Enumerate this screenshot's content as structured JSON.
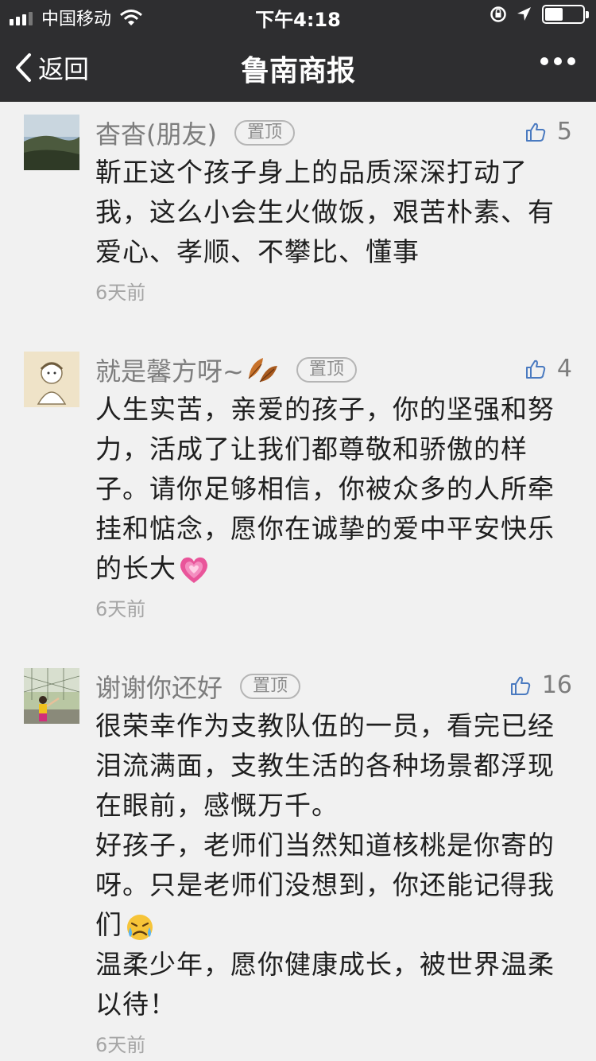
{
  "status": {
    "carrier": "中国移动",
    "time": "下午4:18"
  },
  "nav": {
    "back_label": "返回",
    "title": "鲁南商报"
  },
  "comments": [
    {
      "name": "杳杳(朋友)",
      "pin_label": "置顶",
      "likes": "5",
      "lines": [
        "靳正这个孩子身上的品质深深打动了",
        "我，这么小会生火做饭，艰苦朴素、有",
        "爱心、孝顺、不攀比、懂事"
      ],
      "time": "6天前"
    },
    {
      "name": "就是馨方呀~",
      "name_emoji": "fallen-leaf-icon",
      "pin_label": "置顶",
      "likes": "4",
      "lines": [
        "人生实苦，亲爱的孩子，你的坚强和努",
        "力，活成了让我们都尊敬和骄傲的样",
        "子。请你足够相信，你被众多的人所牵",
        "挂和惦念，愿你在诚挚的爱中平安快乐",
        "的长大"
      ],
      "line_emoji": "growing-heart-icon",
      "time": "6天前"
    },
    {
      "name": "谢谢你还好",
      "pin_label": "置顶",
      "likes": "16",
      "lines": [
        "很荣幸作为支教队伍的一员，看完已经",
        "泪流满面，支教生活的各种场景都浮现",
        "在眼前，感慨万千。",
        "好孩子，老师们当然知道核桃是你寄的",
        "呀。只是老师们没想到，你还能记得我",
        "们",
        "温柔少年，愿你健康成长，被世界温柔",
        "以待！"
      ],
      "line_emoji": "crying-face-icon",
      "time": "6天前"
    }
  ],
  "colors": {
    "header_bg": "#2e2e30",
    "page_bg": "#f1f1f1",
    "thumb_blue": "#4a7ac0"
  }
}
